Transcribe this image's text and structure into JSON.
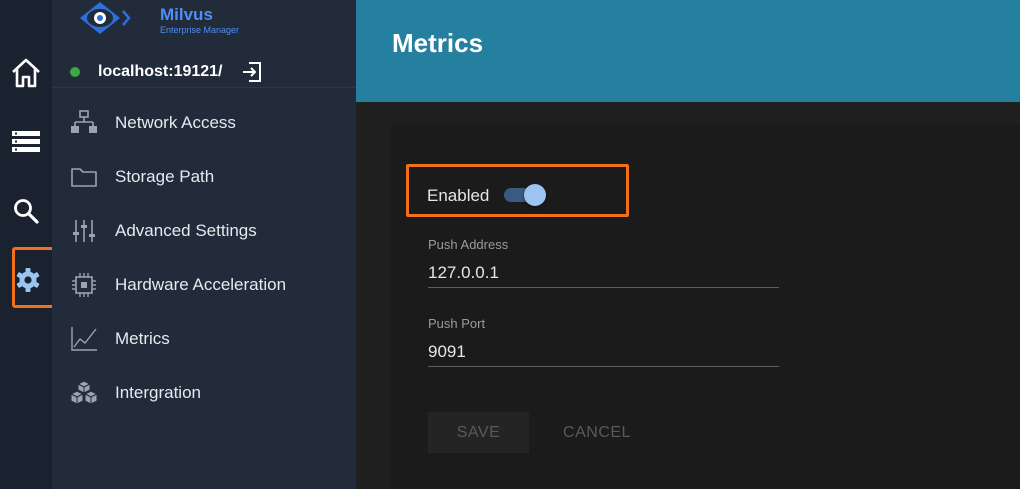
{
  "app": {
    "logo_name": "Milvus",
    "logo_subtitle": "Enterprise Manager"
  },
  "connection": {
    "host": "localhost:19121/",
    "status_color": "#3fa844"
  },
  "rail": {
    "items": [
      {
        "icon": "home-icon"
      },
      {
        "icon": "list-icon"
      },
      {
        "icon": "search-icon"
      },
      {
        "icon": "gear-icon",
        "active": true
      }
    ]
  },
  "sidebar": {
    "items": [
      {
        "label": "Network Access",
        "icon": "network-icon"
      },
      {
        "label": "Storage Path",
        "icon": "folder-icon"
      },
      {
        "label": "Advanced Settings",
        "icon": "sliders-icon"
      },
      {
        "label": "Hardware Acceleration",
        "icon": "chip-icon"
      },
      {
        "label": "Metrics",
        "icon": "chart-icon"
      },
      {
        "label": "Intergration",
        "icon": "cubes-icon"
      }
    ]
  },
  "main": {
    "title": "Metrics",
    "enabled_label": "Enabled",
    "enabled": true,
    "push_address_label": "Push Address",
    "push_address_value": "127.0.0.1",
    "push_port_label": "Push Port",
    "push_port_value": "9091",
    "save_label": "SAVE",
    "cancel_label": "CANCEL"
  },
  "colors": {
    "header": "#24809e",
    "highlight": "#f0701e",
    "brand": "#4d8ff5"
  }
}
